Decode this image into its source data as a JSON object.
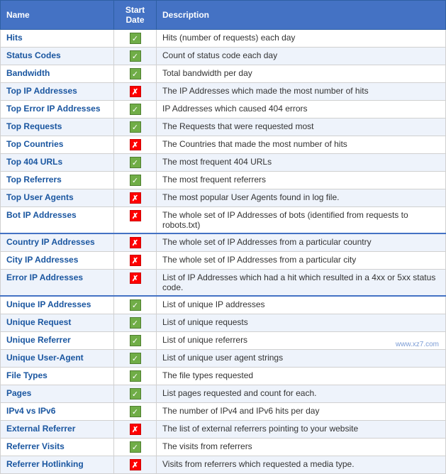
{
  "table": {
    "headers": [
      "Name",
      "Start Date",
      "Description"
    ],
    "rows": [
      {
        "name": "Hits",
        "icon": "check",
        "description": "Hits (number of requests) each day",
        "divider": false
      },
      {
        "name": "Status Codes",
        "icon": "check",
        "description": "Count of status code each day",
        "divider": false
      },
      {
        "name": "Bandwidth",
        "icon": "check",
        "description": "Total bandwidth per day",
        "divider": false
      },
      {
        "name": "Top IP Addresses",
        "icon": "cross",
        "description": "The IP Addresses which made the most number of hits",
        "divider": false
      },
      {
        "name": "Top Error IP Addresses",
        "icon": "check",
        "description": "IP Addresses which caused 404 errors",
        "divider": false
      },
      {
        "name": "Top Requests",
        "icon": "check",
        "description": "The Requests that were requested most",
        "divider": false
      },
      {
        "name": "Top Countries",
        "icon": "cross",
        "description": "The Countries that made the most number of hits",
        "divider": false
      },
      {
        "name": "Top 404 URLs",
        "icon": "check",
        "description": "The most frequent 404 URLs",
        "divider": false
      },
      {
        "name": "Top Referrers",
        "icon": "check",
        "description": "The most frequent referrers",
        "divider": false
      },
      {
        "name": "Top User Agents",
        "icon": "cross",
        "description": "The most popular User Agents found in log file.",
        "divider": false
      },
      {
        "name": "Bot IP Addresses",
        "icon": "cross",
        "description": "The whole set of IP Addresses of bots (identified from requests to robots.txt)",
        "divider": false
      },
      {
        "name": "Country IP Addresses",
        "icon": "cross",
        "description": "The whole set of IP Addresses from a particular country",
        "divider": true
      },
      {
        "name": "City IP Addresses",
        "icon": "cross",
        "description": "The whole set of IP Addresses from a particular city",
        "divider": false
      },
      {
        "name": "Error IP Addresses",
        "icon": "cross",
        "description": "List of IP Addresses which had a hit which resulted in a 4xx or 5xx status code.",
        "divider": false
      },
      {
        "name": "Unique IP Addresses",
        "icon": "check",
        "description": "List of unique IP addresses",
        "divider": true
      },
      {
        "name": "Unique Request",
        "icon": "check",
        "description": "List of unique requests",
        "divider": false
      },
      {
        "name": "Unique Referrer",
        "icon": "check",
        "description": "List of unique referrers",
        "divider": false
      },
      {
        "name": "Unique User-Agent",
        "icon": "check",
        "description": "List of unique user agent strings",
        "divider": false
      },
      {
        "name": "File Types",
        "icon": "check",
        "description": "The file types requested",
        "divider": false
      },
      {
        "name": "Pages",
        "icon": "check",
        "description": "List pages requested and count for each.",
        "divider": false
      },
      {
        "name": "IPv4 vs IPv6",
        "icon": "check",
        "description": "The number of IPv4 and IPv6 hits per day",
        "divider": false
      },
      {
        "name": "External Referrer",
        "icon": "cross",
        "description": "The list of external referrers pointing to your website",
        "divider": false
      },
      {
        "name": "Referrer Visits",
        "icon": "check",
        "description": "The visits from referrers",
        "divider": false
      },
      {
        "name": "Referrer Hotlinking",
        "icon": "cross",
        "description": "Visits from referrers which requested a media type.",
        "divider": false
      }
    ]
  },
  "watermark": "www.xz7.com"
}
